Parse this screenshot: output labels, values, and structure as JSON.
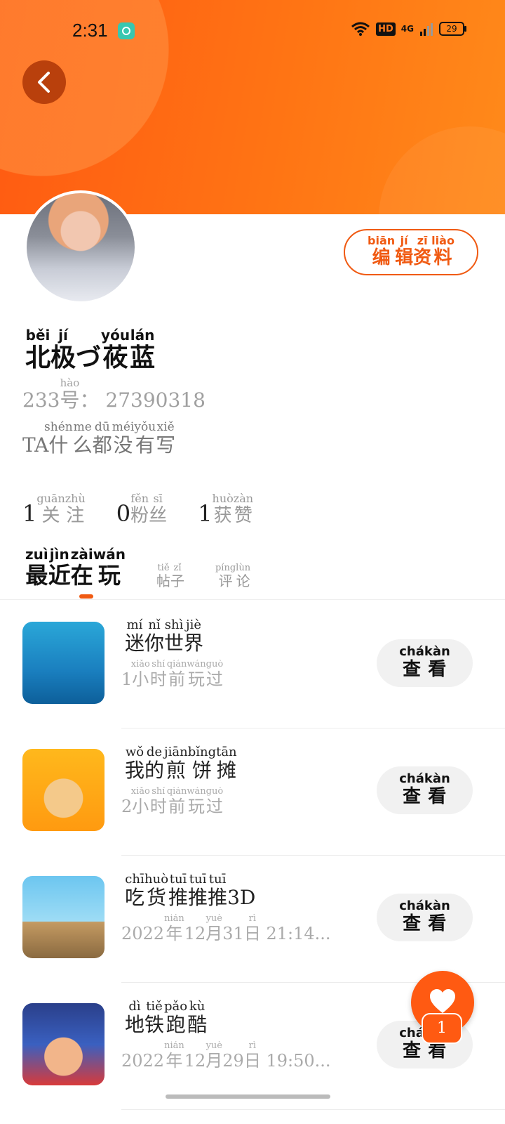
{
  "status_bar": {
    "time": "2:31",
    "network": "4G",
    "hd_label": "HD",
    "battery": "29"
  },
  "profile": {
    "edit_profile": {
      "text": [
        "编",
        "辑",
        "资",
        "料"
      ],
      "pinyin": [
        "biān",
        "jí",
        "zī",
        "liào"
      ]
    },
    "name": {
      "text": [
        "北",
        "极",
        "づ",
        "莜",
        "蓝"
      ],
      "pinyin": [
        "běi",
        "jí",
        "",
        "yóu",
        "lán"
      ]
    },
    "id_prefix": "233",
    "id_hao": "号",
    "id_hao_pinyin": "hào",
    "id_sep": "：",
    "id_number": "27390318",
    "bio_prefix": "TA",
    "bio": {
      "text": [
        "什",
        "么",
        "都",
        "没",
        "有",
        "写"
      ],
      "pinyin": [
        "shén",
        "me",
        "dū",
        "méi",
        "yǒu",
        "xiě"
      ]
    }
  },
  "stats": [
    {
      "count": "1",
      "text": [
        "关",
        "注"
      ],
      "pinyin": [
        "guān",
        "zhù"
      ]
    },
    {
      "count": "0",
      "text": [
        "粉",
        "丝"
      ],
      "pinyin": [
        "fěn",
        "sī"
      ]
    },
    {
      "count": "1",
      "text": [
        "获",
        "赞"
      ],
      "pinyin": [
        "huò",
        "zàn"
      ]
    }
  ],
  "tabs": [
    {
      "text": [
        "最",
        "近",
        "在",
        "玩"
      ],
      "pinyin": [
        "zuì",
        "jìn",
        "zài",
        "wán"
      ],
      "active": true
    },
    {
      "text": [
        "帖",
        "子"
      ],
      "pinyin": [
        "tiě",
        "zǐ"
      ],
      "active": false
    },
    {
      "text": [
        "评",
        "论"
      ],
      "pinyin": [
        "píng",
        "lùn"
      ],
      "active": false
    }
  ],
  "view_button": {
    "text": [
      "查",
      "看"
    ],
    "pinyin": [
      "chá",
      "kàn"
    ]
  },
  "games": [
    {
      "title": {
        "text": [
          "迷",
          "你",
          "世",
          "界"
        ],
        "pinyin": [
          "mí",
          "nǐ",
          "shì",
          "jiè"
        ],
        "suffix": ""
      },
      "sub": {
        "prefix": "1",
        "text": [
          "小",
          "时",
          "前",
          "玩",
          "过"
        ],
        "pinyin": [
          "xiǎo",
          "shí",
          "qián",
          "wán",
          "guò"
        ]
      },
      "icon": "mini-world-icon"
    },
    {
      "title": {
        "text": [
          "我",
          "的",
          "煎",
          "饼",
          "摊"
        ],
        "pinyin": [
          "wǒ",
          "de",
          "jiān",
          "bǐng",
          "tān"
        ],
        "suffix": ""
      },
      "sub": {
        "prefix": "2",
        "text": [
          "小",
          "时",
          "前",
          "玩",
          "过"
        ],
        "pinyin": [
          "xiǎo",
          "shí",
          "qián",
          "wán",
          "guò"
        ]
      },
      "icon": "pancake-stall-icon"
    },
    {
      "title": {
        "text": [
          "吃",
          "货",
          "推",
          "推",
          "推"
        ],
        "pinyin": [
          "chī",
          "huò",
          "tuī",
          "tuī",
          "tuī"
        ],
        "suffix": "3D"
      },
      "sub": {
        "date": "2022年12月31日 21:14...",
        "parts": [
          "2022",
          "年",
          "12",
          "月",
          "31",
          "日",
          " 21:14..."
        ],
        "pinyin": [
          "",
          "nián",
          "",
          "yuè",
          "",
          "rì",
          ""
        ]
      },
      "icon": "push-game-icon"
    },
    {
      "title": {
        "text": [
          "地",
          "铁",
          "跑",
          "酷"
        ],
        "pinyin": [
          "dì",
          "tiě",
          "pǎo",
          "kù"
        ],
        "suffix": ""
      },
      "sub": {
        "parts": [
          "2022",
          "年",
          "12",
          "月",
          "29",
          "日",
          " 19:50..."
        ],
        "pinyin": [
          "",
          "nián",
          "",
          "yuè",
          "",
          "rì",
          ""
        ]
      },
      "icon": "subway-surfers-icon"
    }
  ],
  "fab": {
    "count": "1",
    "icon": "heart-icon"
  },
  "colors": {
    "accent": "#f05a12",
    "header_start": "#ff5a12",
    "header_end": "#ff8a1a"
  }
}
